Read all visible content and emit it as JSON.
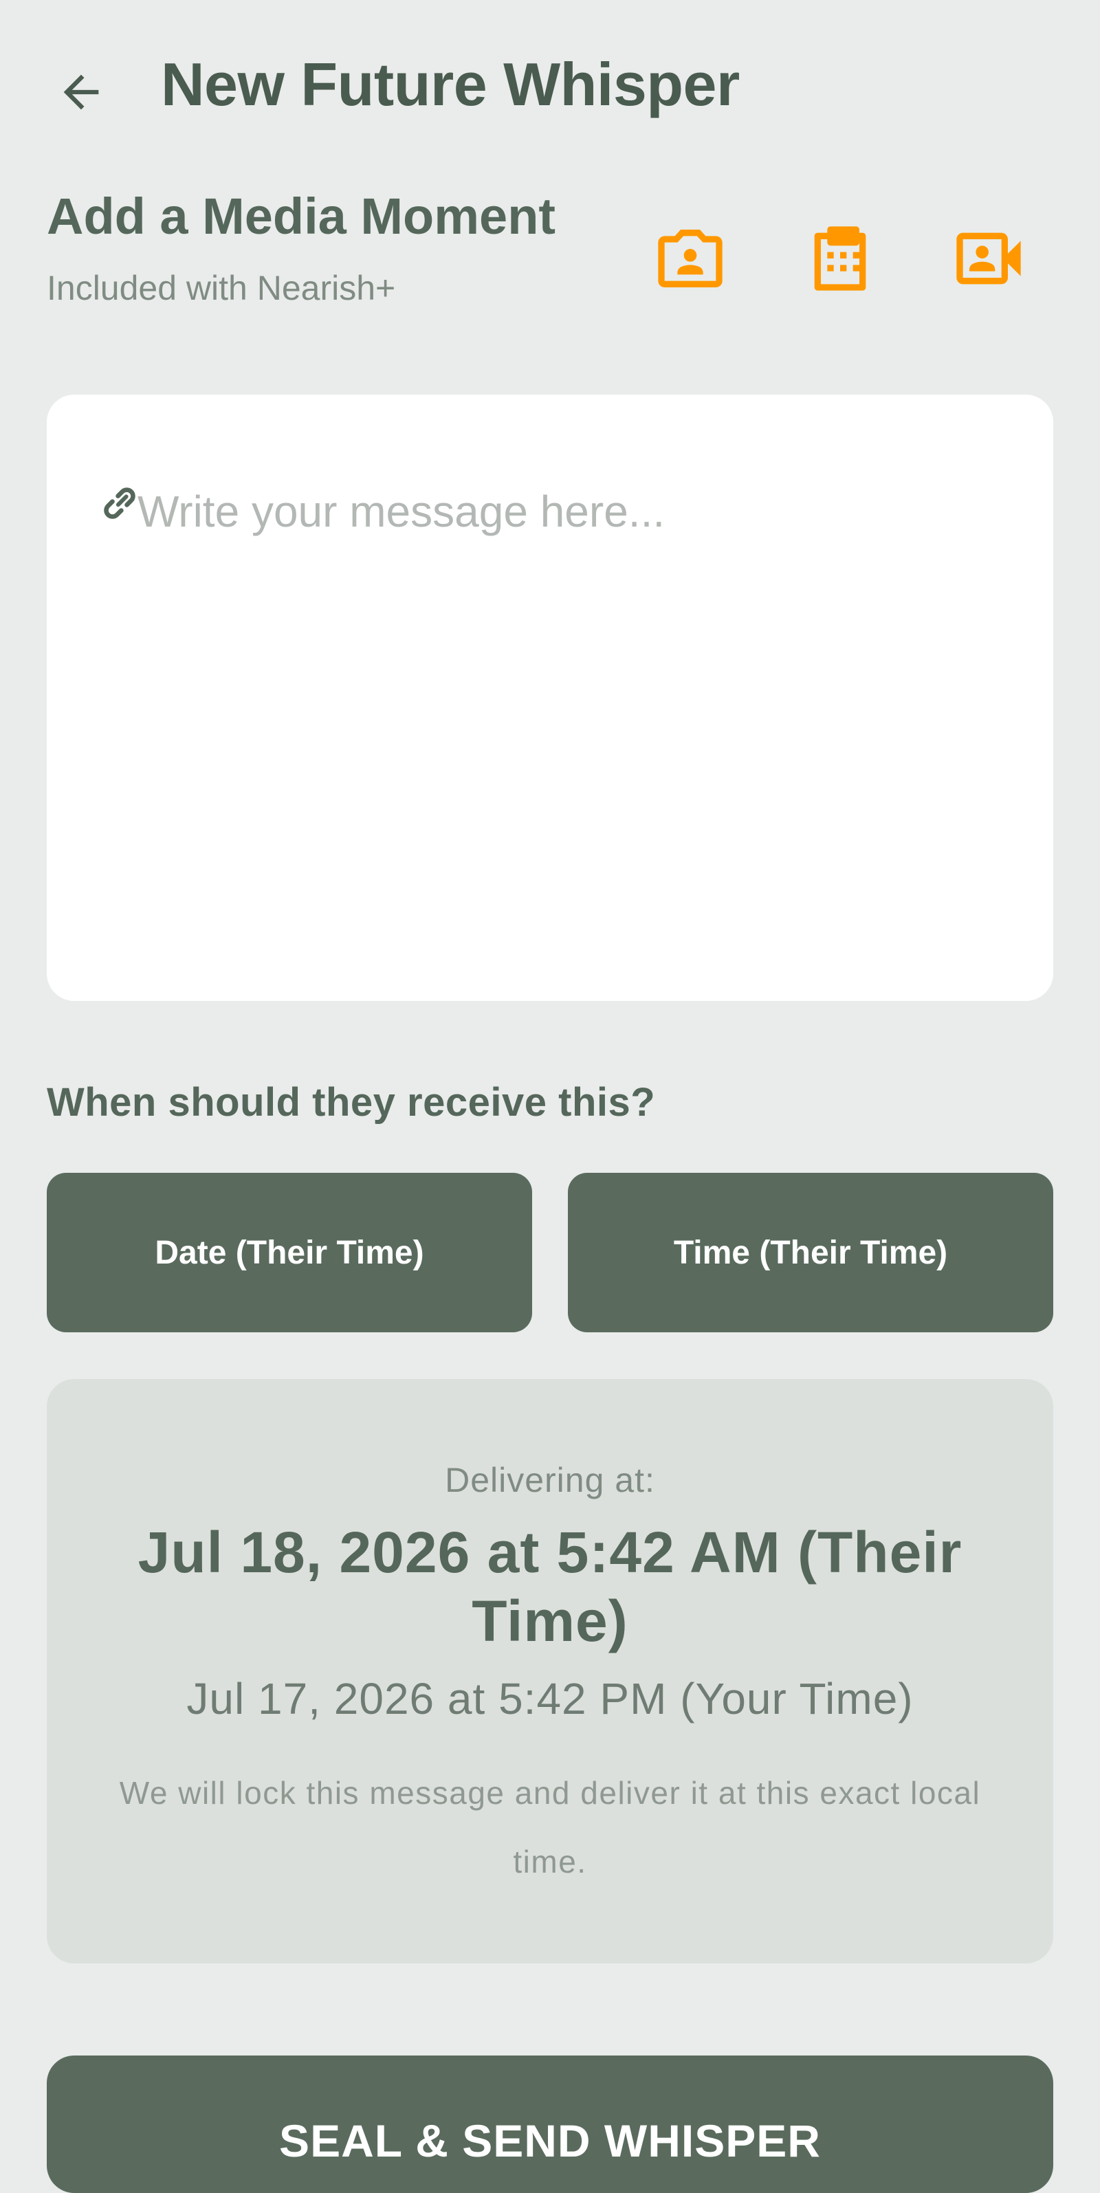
{
  "header": {
    "title": "New Future Whisper",
    "back_icon": "arrow-left-icon"
  },
  "media": {
    "title": "Add a Media Moment",
    "subtitle": "Included with Nearish+",
    "accent_color": "#ff9800",
    "buttons": [
      {
        "icon": "camera-icon"
      },
      {
        "icon": "film-gallery-icon"
      },
      {
        "icon": "video-icon"
      }
    ]
  },
  "message": {
    "placeholder": "Write your message here...",
    "value": "",
    "attach_icon": "link-icon"
  },
  "schedule": {
    "label": "When should they receive this?",
    "date_button": "Date (Their Time)",
    "time_button": "Time (Their Time)"
  },
  "delivery": {
    "label": "Delivering at:",
    "their_time": "Jul 18, 2026 at 5:42 AM (Their Time)",
    "your_time": "Jul 17, 2026 at 5:42 PM (Your Time)",
    "note": "We will lock this message and deliver it at this exact local time."
  },
  "send": {
    "label": "SEAL & SEND WHISPER"
  },
  "colors": {
    "background": "#e9eceb",
    "primary": "#5a6b5e",
    "card": "#ffffff",
    "delivery_card": "#dce0dc"
  }
}
